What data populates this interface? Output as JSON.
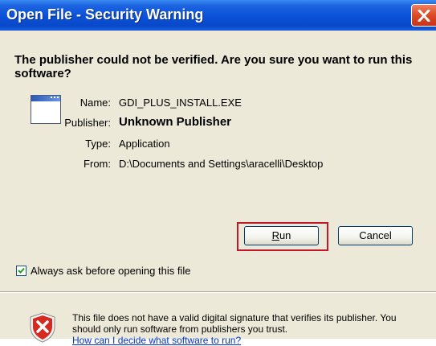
{
  "window": {
    "title": "Open File - Security Warning"
  },
  "heading": "The publisher could not be verified.  Are you sure you want to run this software?",
  "file_info": {
    "name_label": "Name:",
    "name_value": "GDI_PLUS_INSTALL.EXE",
    "publisher_label": "Publisher:",
    "publisher_value": "Unknown Publisher",
    "type_label": "Type:",
    "type_value": "Application",
    "from_label": "From:",
    "from_value": "D:\\Documents and Settings\\aracelli\\Desktop"
  },
  "buttons": {
    "run_accel": "R",
    "run_rest": "un",
    "cancel": "Cancel"
  },
  "checkbox": {
    "label": "Always ask before opening this file",
    "checked": true
  },
  "warning": {
    "text": "This file does not have a valid digital signature that verifies its publisher.  You should only run software from publishers you trust.",
    "link": "How can I decide what software to run?"
  },
  "colors": {
    "title_bar": "#0a50d8",
    "highlight": "#c0182a",
    "link": "#0033cc",
    "dialog_bg": "#ece9d8"
  }
}
